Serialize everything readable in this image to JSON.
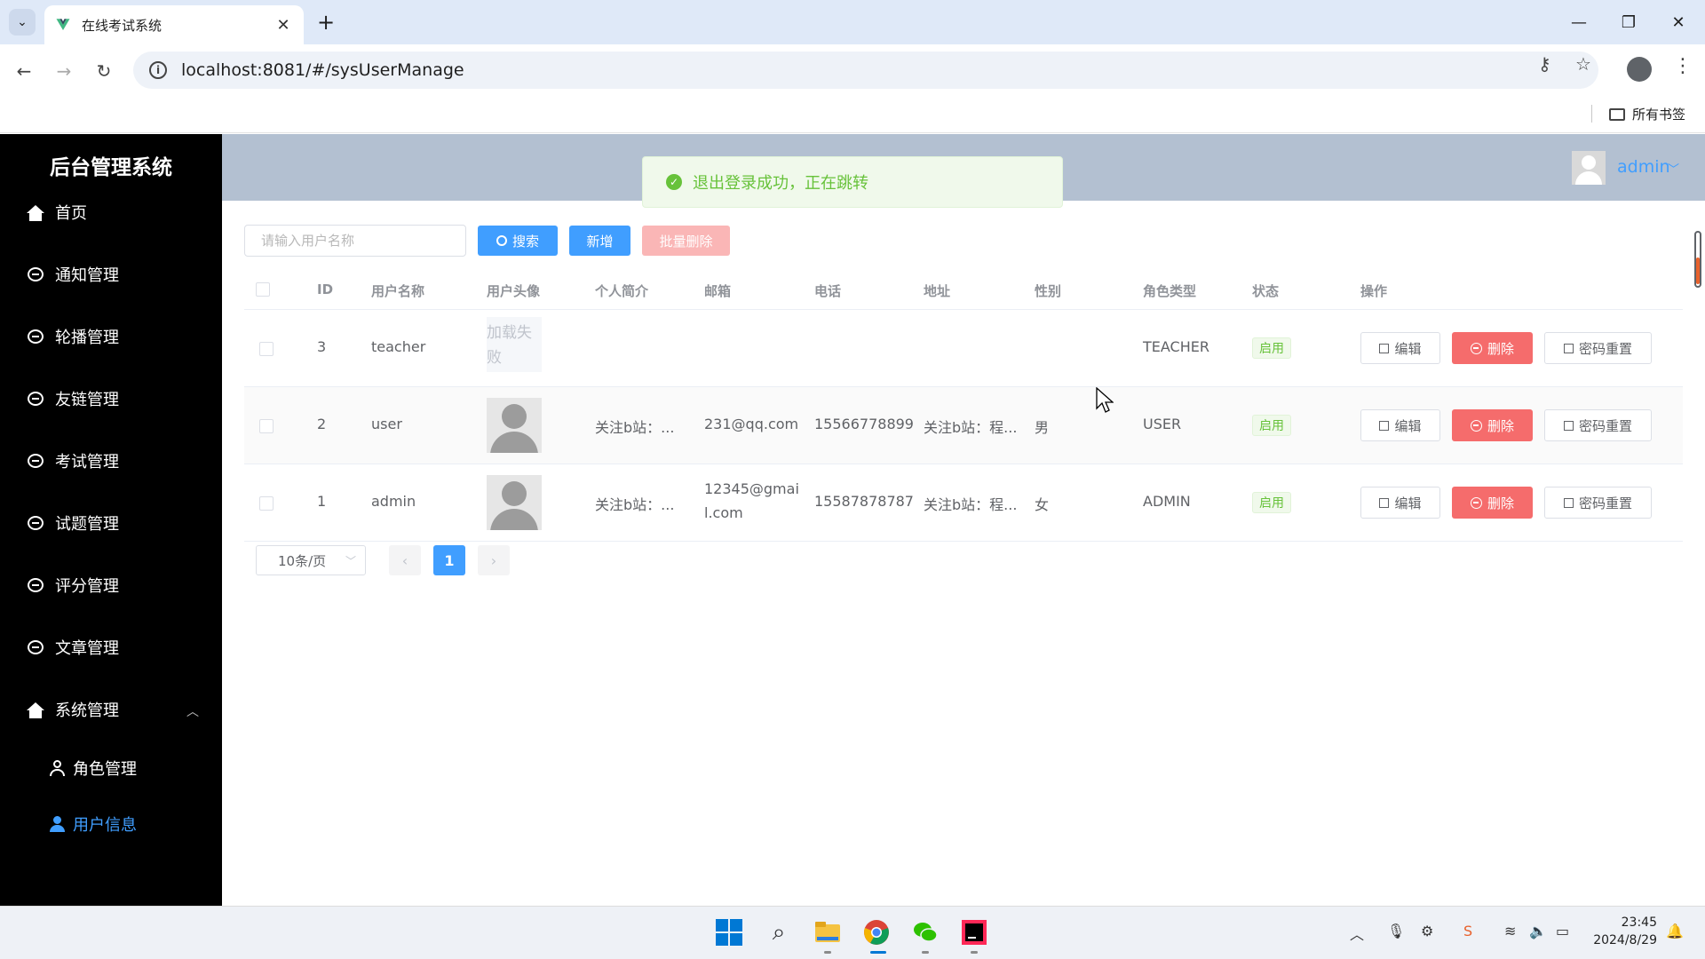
{
  "browser": {
    "tab_title": "在线考试系统",
    "url": "localhost:8081/#/sysUserManage",
    "bookmarks_all": "所有书签"
  },
  "sidebar": {
    "logo": "后台管理系统",
    "items": [
      {
        "label": "首页",
        "icon": "home-icon"
      },
      {
        "label": "通知管理",
        "icon": "chat-icon"
      },
      {
        "label": "轮播管理",
        "icon": "chat-icon"
      },
      {
        "label": "友链管理",
        "icon": "chat-icon"
      },
      {
        "label": "考试管理",
        "icon": "chat-icon"
      },
      {
        "label": "试题管理",
        "icon": "chat-icon"
      },
      {
        "label": "评分管理",
        "icon": "chat-icon"
      },
      {
        "label": "文章管理",
        "icon": "chat-icon"
      },
      {
        "label": "系统管理",
        "icon": "home-icon",
        "expanded": true
      }
    ],
    "sub_items": [
      {
        "label": "角色管理",
        "active": false
      },
      {
        "label": "用户信息",
        "active": true
      }
    ],
    "active_color": "#409eff"
  },
  "header": {
    "username": "admin"
  },
  "toast": {
    "text": "退出登录成功，正在跳转",
    "type": "success"
  },
  "toolbar": {
    "search_placeholder": "请输入用户名称",
    "search_label": "搜索",
    "add_label": "新增",
    "batch_delete_label": "批量删除"
  },
  "table": {
    "columns": [
      "ID",
      "用户名称",
      "用户头像",
      "个人简介",
      "邮箱",
      "电话",
      "地址",
      "性别",
      "角色类型",
      "状态",
      "操作"
    ],
    "rows": [
      {
        "id": "3",
        "username": "teacher",
        "avatar": "加载失败",
        "avatar_fail_line1": "加载失",
        "avatar_fail_line2": "败",
        "bio": "",
        "email_line1": "",
        "email_line2": "",
        "phone": "",
        "address": "",
        "gender": "",
        "role": "TEACHER",
        "status": "启用"
      },
      {
        "id": "2",
        "username": "user",
        "avatar": "default",
        "bio": "关注b站：...",
        "email_line1": "231@qq.com",
        "email_line2": "",
        "phone": "15566778899",
        "address": "关注b站：程...",
        "gender": "男",
        "role": "USER",
        "status": "启用"
      },
      {
        "id": "1",
        "username": "admin",
        "avatar": "default",
        "bio": "关注b站：...",
        "email_line1": "12345@gmai",
        "email_line2": "l.com",
        "phone": "15587878787",
        "address": "关注b站：程...",
        "gender": "女",
        "role": "ADMIN",
        "status": "启用"
      }
    ],
    "actions": {
      "edit": "编辑",
      "delete": "删除",
      "reset": "密码重置"
    }
  },
  "pagination": {
    "page_size": "10条/页",
    "current_page": "1",
    "prev": "‹",
    "next": "›"
  },
  "taskbar": {
    "time": "23:45",
    "date": "2024/8/29"
  }
}
